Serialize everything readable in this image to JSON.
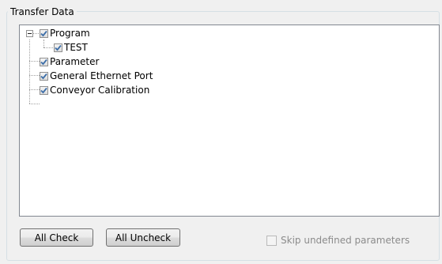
{
  "group": {
    "title": "Transfer Data"
  },
  "tree": {
    "root": {
      "label": "Program",
      "checked": true,
      "expanded": true
    },
    "child": {
      "label": "TEST",
      "checked": true
    },
    "items": [
      {
        "label": "Parameter",
        "checked": true
      },
      {
        "label": "General Ethernet Port",
        "checked": true
      },
      {
        "label": "Conveyor Calibration",
        "checked": true
      }
    ]
  },
  "buttons": {
    "all_check": "All Check",
    "all_uncheck": "All Uncheck"
  },
  "options": {
    "skip_label": "Skip undefined parameters",
    "skip_checked": false,
    "skip_enabled": false
  },
  "colors": {
    "check_mark": "#3d6ea8",
    "disabled_text": "#8b8b8b"
  }
}
